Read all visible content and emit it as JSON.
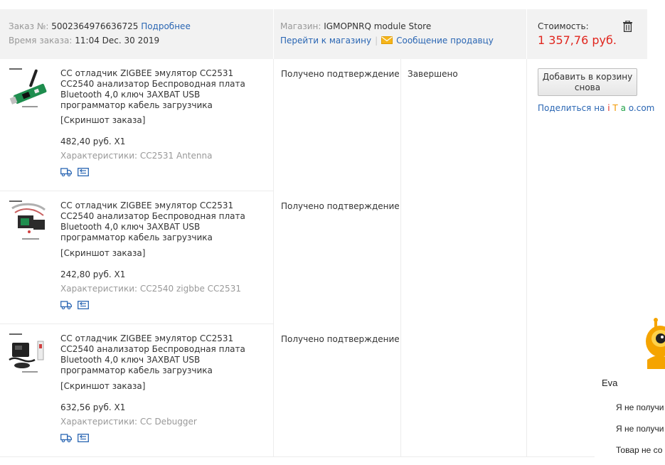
{
  "header": {
    "order_label": "Заказ №:",
    "order_number": "5002364976636725",
    "details_link": "Подробнее",
    "time_label": "Время заказа:",
    "time_value": "11:04 Dec. 30 2019",
    "store_label": "Магазин:",
    "store_name": "IGMOPNRQ module Store",
    "goto_store": "Перейти к магазину",
    "message_seller": "Сообщение продавцу",
    "cost_label": "Стоимость:",
    "cost_value": "1 357,76 руб."
  },
  "products": [
    {
      "title": "CC отладчик ZIGBEE эмулятор CC2531 CC2540 анализатор Беспроводная плата Bluetooth 4,0 ключ 3AXBAT USB программатор кабель загрузчика",
      "snapshot": "[Скриншот заказа]",
      "price": "482,40 руб. X1",
      "specs": "Характеристики: CC2531 Antenna",
      "status": "Получено подтверждение"
    },
    {
      "title": "CC отладчик ZIGBEE эмулятор CC2531 CC2540 анализатор Беспроводная плата Bluetooth 4,0 ключ 3AXBAT USB программатор кабель загрузчика",
      "snapshot": "[Скриншот заказа]",
      "price": "242,80 руб. X1",
      "specs": "Характеристики: CC2540 zigbbe CC2531",
      "status": "Получено подтверждение"
    },
    {
      "title": "CC отладчик ZIGBEE эмулятор CC2531 CC2540 анализатор Беспроводная плата Bluetooth 4,0 ключ 3AXBAT USB программатор кабель загрузчика",
      "snapshot": "[Скриншот заказа]",
      "price": "632,56 руб. X1",
      "specs": "Характеристики: CC Debugger",
      "status": "Получено подтверждение"
    }
  ],
  "order_status": "Завершено",
  "actions": {
    "readd_button": "Добавить в корзину снова",
    "share_prefix": "Поделиться на",
    "share_i": "i",
    "share_t": "T",
    "share_a": "a",
    "share_o": "o",
    "share_suffix": ".com"
  },
  "chat": {
    "agent_name": "Eva",
    "messages": [
      "Я не получи",
      "Я не получи",
      "Товар не со"
    ]
  },
  "colors": {
    "link": "#2a66b3",
    "price": "#e0251d",
    "header_bg": "#f2f2f2"
  }
}
